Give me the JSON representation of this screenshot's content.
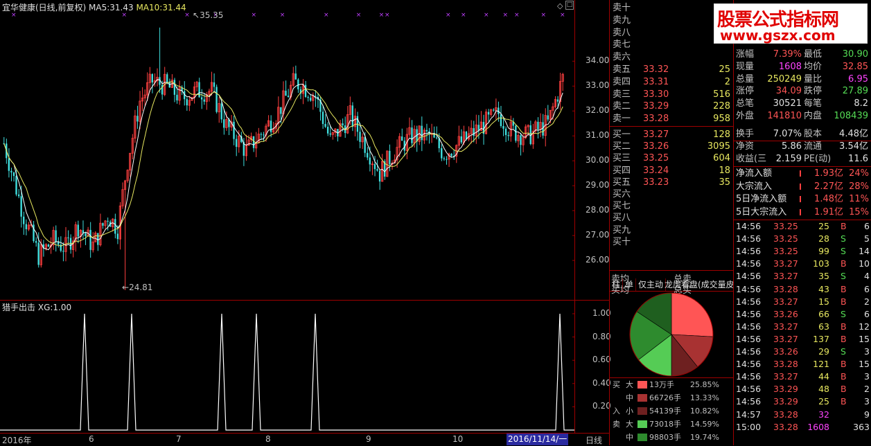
{
  "header": {
    "title": "宜华健康(日线,前复权)",
    "ma5_label": "MA5:",
    "ma5": "31.43",
    "ma10_label": "MA10:",
    "ma10": "31.44"
  },
  "main_axis": {
    "ticks": [
      "34.00",
      "33.00",
      "32.00",
      "31.00",
      "30.00",
      "29.00",
      "28.00",
      "27.00",
      "26.00"
    ]
  },
  "annotations": {
    "high": "35.35",
    "low": "24.81"
  },
  "indicator": {
    "title": "猎手出击",
    "xg_label": "XG:",
    "xg_value": "1.00",
    "ticks": [
      "1.00",
      "0.80",
      "0.60",
      "0.40",
      "0.20"
    ]
  },
  "x_axis": {
    "labels": [
      "2016年",
      "6",
      "7",
      "8",
      "9",
      "10"
    ],
    "current": "2016/11/14/一",
    "period": "日线"
  },
  "watermark": {
    "line1": "股票公式指标网",
    "line2": "www.gszx.com"
  },
  "orderbook": {
    "sells": [
      {
        "label": "卖十"
      },
      {
        "label": "卖九"
      },
      {
        "label": "卖八"
      },
      {
        "label": "卖七"
      },
      {
        "label": "卖六"
      },
      {
        "label": "卖五",
        "price": "33.32",
        "vol": "25"
      },
      {
        "label": "卖四",
        "price": "33.31",
        "vol": "2"
      },
      {
        "label": "卖三",
        "price": "33.30",
        "vol": "516"
      },
      {
        "label": "卖二",
        "price": "33.29",
        "vol": "228"
      },
      {
        "label": "卖一",
        "price": "33.28",
        "vol": "958"
      }
    ],
    "buys": [
      {
        "label": "买一",
        "price": "33.27",
        "vol": "128"
      },
      {
        "label": "买二",
        "price": "33.26",
        "vol": "3095"
      },
      {
        "label": "买三",
        "price": "33.25",
        "vol": "604"
      },
      {
        "label": "买四",
        "price": "33.24",
        "vol": "18"
      },
      {
        "label": "买五",
        "price": "33.23",
        "vol": "35"
      },
      {
        "label": "买六"
      },
      {
        "label": "买七"
      },
      {
        "label": "买八"
      },
      {
        "label": "买九"
      },
      {
        "label": "买十"
      }
    ],
    "sell_avg": "卖均",
    "total_sell": "总卖",
    "buy_avg": "买均",
    "total_buy": "总买"
  },
  "tabs": [
    "柱",
    "单",
    "仅主动",
    "龙虎看盘(成交量皮"
  ],
  "pie_legend": {
    "buy_label": [
      "买",
      "入"
    ],
    "sell_label": [
      "卖"
    ],
    "rows": [
      {
        "size": "大",
        "color": "#ff5555",
        "vol": "13万手",
        "pct": "25.85%"
      },
      {
        "size": "中",
        "color": "#a83232",
        "vol": "66726手",
        "pct": "13.33%"
      },
      {
        "size": "小",
        "color": "#6e2020",
        "vol": "54139手",
        "pct": "10.82%"
      },
      {
        "size": "大",
        "color": "#55cc55",
        "vol": "73018手",
        "pct": "14.59%"
      },
      {
        "size": "中",
        "color": "#2e8b2e",
        "vol": "98803手",
        "pct": "19.74%"
      }
    ]
  },
  "stats": [
    {
      "l1": "涨跌",
      "v1": "",
      "l2": "最低",
      "v2": ""
    },
    {
      "l1": "涨幅",
      "v1": "7.39%",
      "l2": "最低",
      "v2": "30.90"
    },
    {
      "l1": "现量",
      "v1": "1608",
      "l2": "均价",
      "v2": "32.85"
    },
    {
      "l1": "总量",
      "v1": "250249",
      "l2": "量比",
      "v2": "6.95"
    },
    {
      "l1": "涨停",
      "v1": "34.09",
      "l2": "跌停",
      "v2": "27.89"
    },
    {
      "l1": "总笔",
      "v1": "30521",
      "l2": "每笔",
      "v2": "8.2"
    },
    {
      "l1": "外盘",
      "v1": "141810",
      "l2": "内盘",
      "v2": "108439"
    },
    {
      "l1": "换手",
      "v1": "7.07%",
      "l2": "股本",
      "v2": "4.48亿"
    },
    {
      "l1": "净资",
      "v1": "5.86",
      "l2": "流通",
      "v2": "3.54亿"
    },
    {
      "l1": "收益(三",
      "v1": "2.159",
      "l2": "PE(动)",
      "v2": "11.6"
    }
  ],
  "flows": [
    {
      "label": "净流入额",
      "value": "1.93亿",
      "pct": "24%"
    },
    {
      "label": "大宗流入",
      "value": "2.27亿",
      "pct": "28%"
    },
    {
      "label": "5日净流入额",
      "value": "1.48亿",
      "pct": "11%"
    },
    {
      "label": "5日大宗流入",
      "value": "1.91亿",
      "pct": "15%"
    }
  ],
  "trades": [
    {
      "t": "14:56",
      "p": "33.25",
      "v": "25",
      "s": "B",
      "n": "6"
    },
    {
      "t": "14:56",
      "p": "33.25",
      "v": "28",
      "s": "S",
      "n": "5"
    },
    {
      "t": "14:56",
      "p": "33.25",
      "v": "99",
      "s": "S",
      "n": "14"
    },
    {
      "t": "14:56",
      "p": "33.27",
      "v": "103",
      "s": "B",
      "n": "10"
    },
    {
      "t": "14:56",
      "p": "33.27",
      "v": "35",
      "s": "S",
      "n": "4"
    },
    {
      "t": "14:56",
      "p": "33.28",
      "v": "43",
      "s": "B",
      "n": "6"
    },
    {
      "t": "14:56",
      "p": "33.27",
      "v": "15",
      "s": "B",
      "n": "2"
    },
    {
      "t": "14:56",
      "p": "33.26",
      "v": "66",
      "s": "S",
      "n": "6"
    },
    {
      "t": "14:56",
      "p": "33.27",
      "v": "63",
      "s": "B",
      "n": "12"
    },
    {
      "t": "14:56",
      "p": "33.27",
      "v": "137",
      "s": "B",
      "n": "15"
    },
    {
      "t": "14:56",
      "p": "33.26",
      "v": "29",
      "s": "S",
      "n": "3"
    },
    {
      "t": "14:56",
      "p": "33.28",
      "v": "121",
      "s": "B",
      "n": "15"
    },
    {
      "t": "14:56",
      "p": "33.27",
      "v": "44",
      "s": "B",
      "n": "3"
    },
    {
      "t": "14:56",
      "p": "33.29",
      "v": "48",
      "s": "B",
      "n": "2"
    },
    {
      "t": "14:56",
      "p": "33.29",
      "v": "25",
      "s": "B",
      "n": "3"
    },
    {
      "t": "14:57",
      "p": "33.28",
      "v": "32",
      "s": "",
      "n": "9"
    },
    {
      "t": "15:00",
      "p": "33.28",
      "v": "1608",
      "s": "",
      "n": "363"
    }
  ],
  "chart_data": {
    "type": "candlestick",
    "title": "宜华健康(日线,前复权)",
    "ylim": [
      24.5,
      35.9
    ],
    "y_ticks": [
      26,
      27,
      28,
      29,
      30,
      31,
      32,
      33,
      34
    ],
    "x_labels": [
      "2016年",
      "6",
      "7",
      "8",
      "9",
      "10",
      "2016/11/14/一"
    ],
    "high_marker": 35.35,
    "low_marker": 24.81,
    "series": [
      {
        "name": "MA5",
        "last": 31.43
      },
      {
        "name": "MA10",
        "last": 31.44
      }
    ],
    "indicator": {
      "name": "猎手出击",
      "xg": 1.0,
      "ylim": [
        0,
        1.1
      ],
      "spikes": 6
    }
  }
}
